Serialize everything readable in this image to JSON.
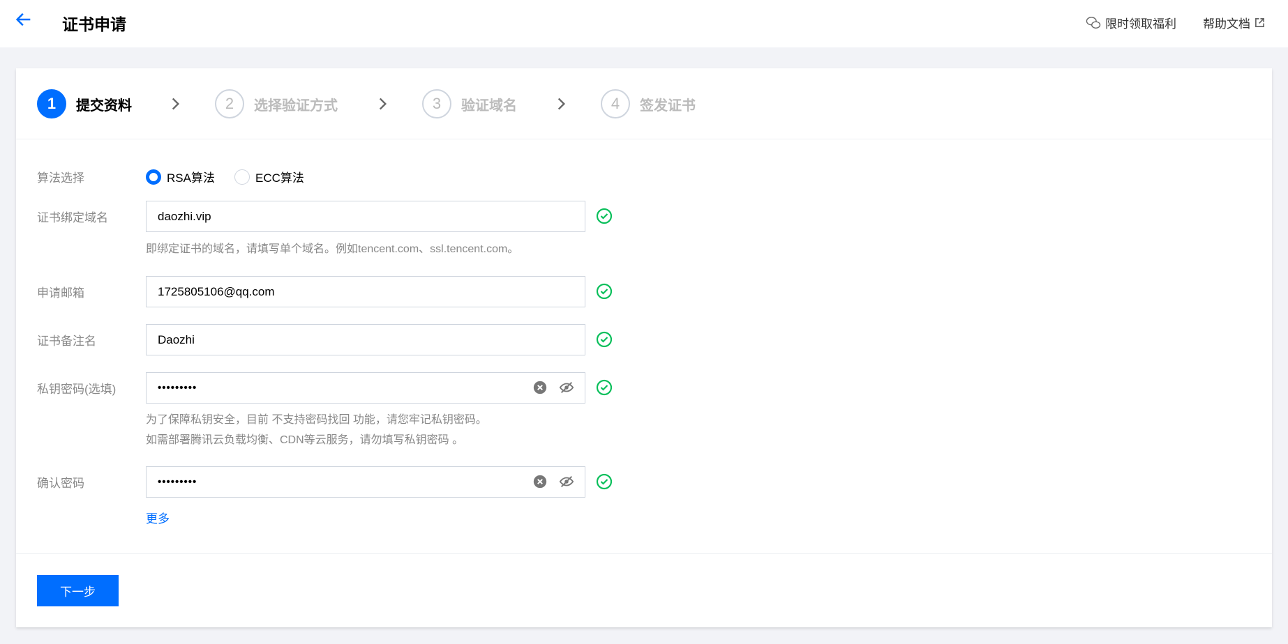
{
  "header": {
    "title": "证书申请",
    "benefit_link": "限时领取福利",
    "help_link": "帮助文档"
  },
  "steps": [
    {
      "num": "1",
      "label": "提交资料"
    },
    {
      "num": "2",
      "label": "选择验证方式"
    },
    {
      "num": "3",
      "label": "验证域名"
    },
    {
      "num": "4",
      "label": "签发证书"
    }
  ],
  "form": {
    "algorithm": {
      "label": "算法选择",
      "options": [
        "RSA算法",
        "ECC算法"
      ],
      "selected": "RSA算法"
    },
    "domain": {
      "label": "证书绑定域名",
      "value": "daozhi.vip",
      "hint": "即绑定证书的域名，请填写单个域名。例如tencent.com、ssl.tencent.com。"
    },
    "email": {
      "label": "申请邮箱",
      "value": "1725805106@qq.com"
    },
    "remark": {
      "label": "证书备注名",
      "value": "Daozhi"
    },
    "password": {
      "label": "私钥密码(选填)",
      "value": "•••••••••",
      "hint1": "为了保障私钥安全，目前 不支持密码找回 功能，请您牢记私钥密码。",
      "hint2": "如需部署腾讯云负载均衡、CDN等云服务，请勿填写私钥密码 。"
    },
    "confirm": {
      "label": "确认密码",
      "value": "•••••••••"
    },
    "more": "更多"
  },
  "next_button": "下一步",
  "colors": {
    "primary": "#006eff",
    "success": "#0abf5b"
  }
}
